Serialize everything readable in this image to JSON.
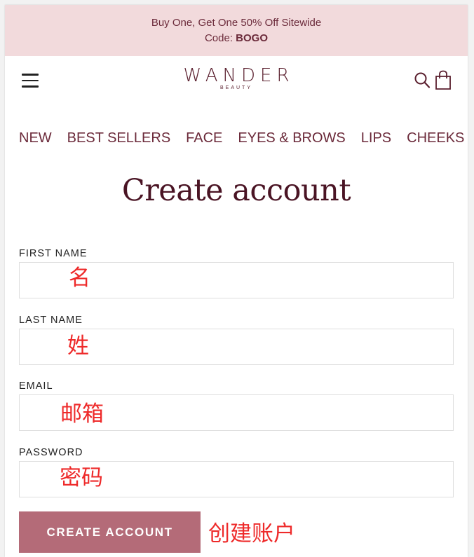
{
  "promo": {
    "line1": "Buy One, Get One 50% Off Sitewide",
    "code_prefix": "Code: ",
    "code": "BOGO"
  },
  "header": {
    "logo_main": "WANDER",
    "logo_sub": "BEAUTY"
  },
  "nav": {
    "items": [
      "NEW",
      "BEST SELLERS",
      "FACE",
      "EYES & BROWS",
      "LIPS",
      "CHEEKS"
    ]
  },
  "page": {
    "title": "Create account"
  },
  "form": {
    "first_name_label": "FIRST NAME",
    "last_name_label": "LAST NAME",
    "email_label": "EMAIL",
    "password_label": "PASSWORD",
    "first_name_value": "",
    "last_name_value": "",
    "email_value": "",
    "password_value": "",
    "submit_label": "CREATE ACCOUNT"
  },
  "annotations": {
    "first_name": "名",
    "last_name": "姓",
    "email": "邮箱",
    "password": "密码",
    "submit": "创建账户"
  },
  "colors": {
    "promo_bg": "#f2dadc",
    "brand": "#6b2a3a",
    "button_bg": "#b46b78",
    "annotation": "#ee2a2a"
  }
}
